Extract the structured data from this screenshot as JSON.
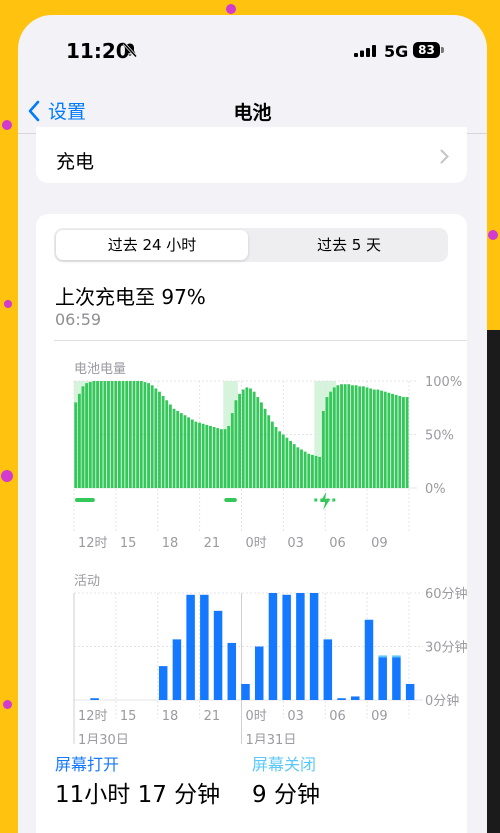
{
  "status_bar": {
    "time": "11:20",
    "network": "5G",
    "battery": "83"
  },
  "nav": {
    "back_label": "设置",
    "title": "电池"
  },
  "charging_row": {
    "label": "充电"
  },
  "segments": {
    "active": "过去 24 小时",
    "inactive": "过去 5 天"
  },
  "last_charge": {
    "label": "上次充电至 97%",
    "time": "06:59"
  },
  "colors": {
    "battery_green": "#34C759",
    "charging_highlight": "#D6F3DC",
    "activity_blue": "#1479FF",
    "screen_off_blue": "#5AC8FA"
  },
  "chart_data": [
    {
      "type": "bar",
      "title": "电池电量",
      "y_ticks": [
        "100%",
        "50%",
        "0%"
      ],
      "ylim": [
        0,
        100
      ],
      "x_ticks": [
        "12时",
        "15",
        "18",
        "21",
        "0时",
        "03",
        "06",
        "09"
      ],
      "values": [
        80,
        88,
        95,
        98,
        99,
        100,
        100,
        100,
        100,
        100,
        100,
        100,
        100,
        100,
        100,
        100,
        100,
        100,
        100,
        99,
        98,
        96,
        93,
        90,
        86,
        82,
        78,
        74,
        72,
        70,
        68,
        66,
        64,
        62,
        61,
        60,
        59,
        58,
        57,
        56,
        55,
        55,
        58,
        70,
        82,
        88,
        92,
        94,
        93,
        90,
        85,
        80,
        74,
        68,
        62,
        57,
        53,
        50,
        47,
        44,
        41,
        38,
        36,
        34,
        32,
        31,
        30,
        29,
        72,
        85,
        90,
        94,
        96,
        97,
        97,
        97,
        96,
        96,
        95,
        95,
        94,
        93,
        92,
        92,
        91,
        90,
        89,
        88,
        87,
        86,
        85,
        85
      ],
      "charging_ranges": [
        [
          0,
          6
        ],
        [
          41,
          45
        ],
        [
          66,
          72
        ]
      ]
    },
    {
      "type": "bar",
      "title": "活动",
      "y_ticks": [
        "60分钟",
        "30分钟",
        "0分钟"
      ],
      "ylim": [
        0,
        60
      ],
      "x_ticks": [
        "12时",
        "15",
        "18",
        "21",
        "0时",
        "03",
        "06",
        "09"
      ],
      "date_labels": [
        "1月30日",
        "1月31日"
      ],
      "values": [
        0,
        1,
        0,
        0,
        0,
        0,
        19,
        34,
        59,
        59,
        50,
        32,
        9,
        30,
        60,
        59,
        60,
        60,
        34,
        1,
        2,
        45,
        24,
        24,
        9
      ],
      "off_values": [
        0,
        0,
        0,
        0,
        0,
        0,
        0,
        0,
        0,
        0,
        0,
        0,
        0,
        0,
        0,
        0,
        0,
        0,
        0,
        0,
        0,
        0,
        1,
        1,
        0
      ]
    }
  ],
  "screen_on": {
    "label": "屏幕打开",
    "value": "11小时 17 分钟"
  },
  "screen_off": {
    "label": "屏幕关闭",
    "value": "9 分钟"
  }
}
